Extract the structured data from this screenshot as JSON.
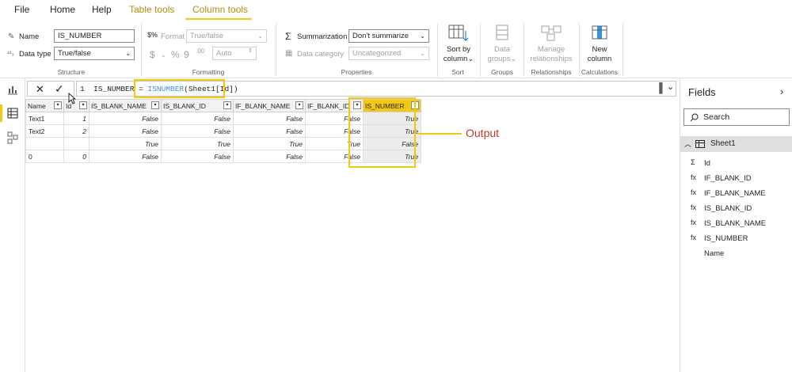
{
  "menu": {
    "tabs": [
      "File",
      "Home",
      "Help",
      "Table tools",
      "Column tools"
    ]
  },
  "ribbon": {
    "structure": {
      "name_label": "Name",
      "name_value": "IS_NUMBER",
      "datatype_label": "Data type",
      "datatype_value": "True/false",
      "group": "Structure"
    },
    "formatting": {
      "format_label": "Format",
      "format_value": "True/false",
      "currency": "$",
      "percent": "%",
      "comma": "9",
      "decimals": ".00",
      "auto_value": "Auto",
      "group": "Formatting"
    },
    "properties": {
      "summarization_label": "Summarization",
      "summarization_value": "Don't summarize",
      "category_label": "Data category",
      "category_value": "Uncategorized",
      "group": "Properties"
    },
    "sort": {
      "button": "Sort by column",
      "line1": "Sort by",
      "line2": "column",
      "group": "Sort"
    },
    "groups": {
      "line1": "Data",
      "line2": "groups",
      "group": "Groups"
    },
    "relationships": {
      "line1": "Manage",
      "line2": "relationships",
      "group": "Relationships"
    },
    "calculations": {
      "line1": "New",
      "line2": "column",
      "group": "Calculations"
    }
  },
  "formula": {
    "line_no": "1",
    "prefix": "IS_NUMBER = ",
    "func": "ISNUMBER",
    "args": "(Sheet1[Id])"
  },
  "table": {
    "headers": [
      "Name",
      "Id",
      "IS_BLANK_NAME",
      "IS_BLANK_ID",
      "IF_BLANK_NAME",
      "IF_BLANK_ID",
      "IS_NUMBER"
    ],
    "rows": [
      [
        "Text1",
        "1",
        "False",
        "False",
        "False",
        "False",
        "True"
      ],
      [
        "Text2",
        "2",
        "False",
        "False",
        "False",
        "False",
        "True"
      ],
      [
        "",
        "",
        "True",
        "True",
        "True",
        "True",
        "False"
      ],
      [
        "0",
        "0",
        "False",
        "False",
        "False",
        "False",
        "True"
      ]
    ]
  },
  "annotation": {
    "label": "Output",
    "color": "#f2c811"
  },
  "fields_pane": {
    "title": "Fields",
    "search_placeholder": "Search",
    "table_name": "Sheet1",
    "items": [
      {
        "icon": "sigma-icon",
        "glyph": "Σ",
        "label": "Id"
      },
      {
        "icon": "calc-column-icon",
        "glyph": "fx",
        "label": "IF_BLANK_ID"
      },
      {
        "icon": "calc-column-icon",
        "glyph": "fx",
        "label": "IF_BLANK_NAME"
      },
      {
        "icon": "calc-column-icon",
        "glyph": "fx",
        "label": "IS_BLANK_ID"
      },
      {
        "icon": "calc-column-icon",
        "glyph": "fx",
        "label": "IS_BLANK_NAME"
      },
      {
        "icon": "calc-column-icon",
        "glyph": "fx",
        "label": "IS_NUMBER"
      },
      {
        "icon": "",
        "glyph": "",
        "label": "Name"
      }
    ]
  },
  "colors": {
    "accent": "#f2c811",
    "accent_text": "#b08e14",
    "output_text": "#c0392b"
  }
}
